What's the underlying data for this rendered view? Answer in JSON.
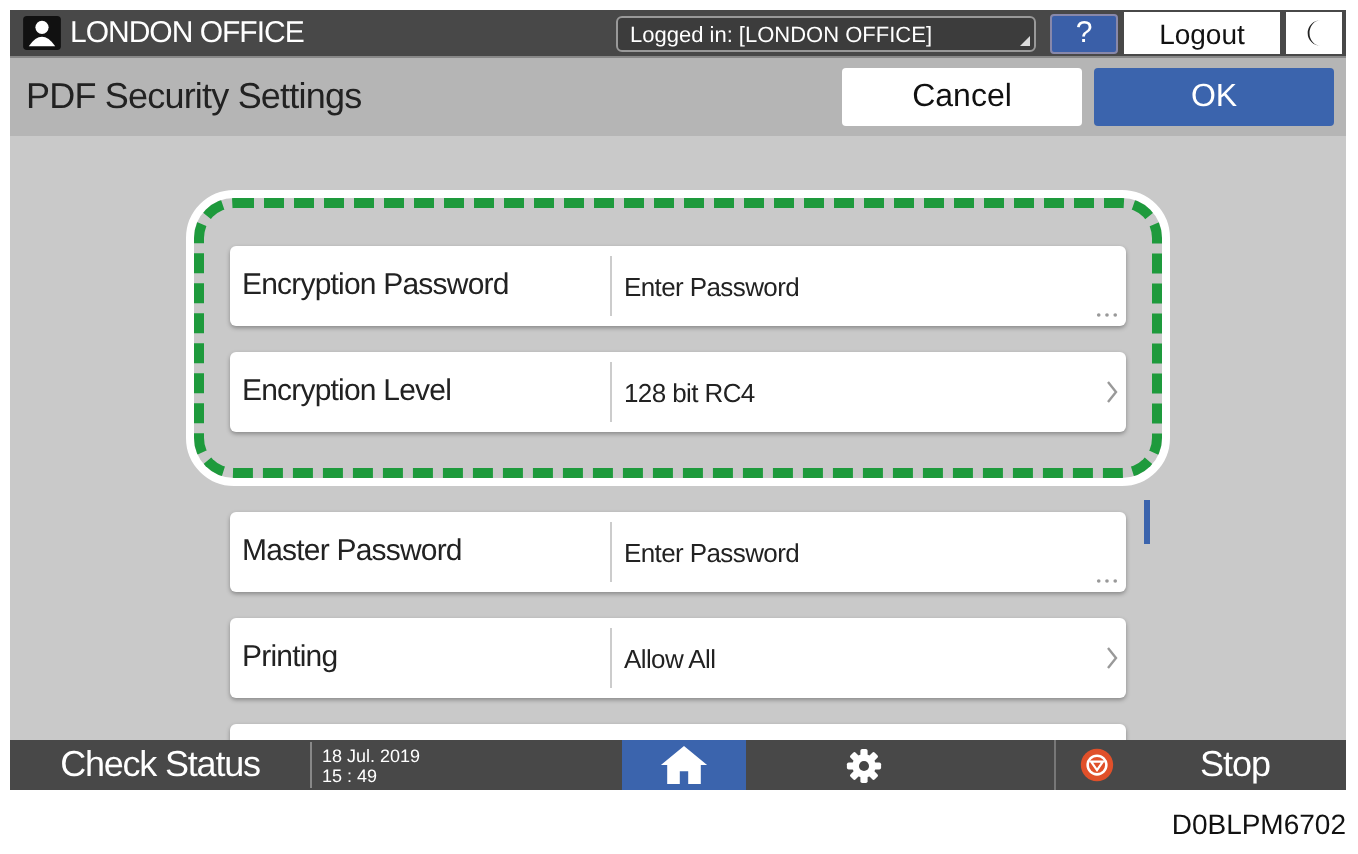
{
  "top_bar": {
    "user": "LONDON OFFICE",
    "login_status": "Logged in: [LONDON OFFICE]",
    "help": "?",
    "logout": "Logout"
  },
  "header": {
    "title": "PDF Security Settings",
    "cancel": "Cancel",
    "ok": "OK"
  },
  "sections": [
    {
      "highlighted": true,
      "rows": [
        {
          "label": "Encryption Password",
          "value": "Enter Password",
          "kind": "input"
        },
        {
          "label": "Encryption Level",
          "value": "128 bit RC4",
          "kind": "select"
        }
      ]
    },
    {
      "highlighted": false,
      "rows": [
        {
          "label": "Master Password",
          "value": "Enter Password",
          "kind": "input"
        },
        {
          "label": "Printing",
          "value": "Allow All",
          "kind": "select"
        }
      ]
    }
  ],
  "bottom_bar": {
    "check_status": "Check Status",
    "date": "18 Jul. 2019",
    "time": "15 : 49",
    "stop": "Stop"
  },
  "figure_code": "D0BLPM6702"
}
